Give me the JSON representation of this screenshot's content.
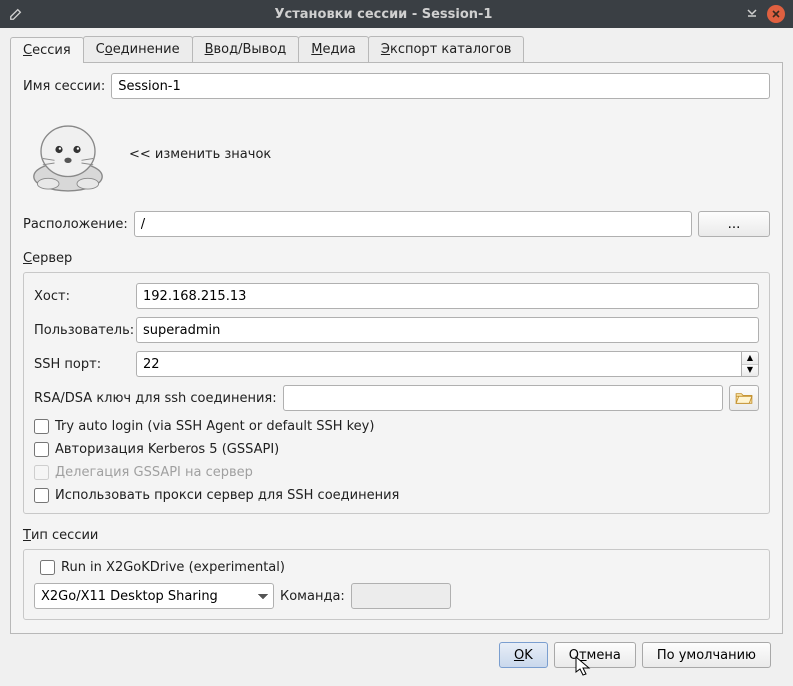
{
  "window": {
    "title": "Установки сессии - Session-1"
  },
  "tabs": {
    "session": "Сессия",
    "connection": "Соединение",
    "io": "Ввод/Вывод",
    "media": "Медиа",
    "export": "Экспорт каталогов"
  },
  "session_name": {
    "label": "Имя сессии:",
    "value": "Session-1"
  },
  "change_icon": "<< изменить значок",
  "location": {
    "label": "Расположение:",
    "value": "/",
    "browse": "..."
  },
  "server": {
    "title": "Сервер",
    "host_label": "Хост:",
    "host_value": "192.168.215.13",
    "user_label": "Пользователь:",
    "user_value": "superadmin",
    "sshport_label": "SSH порт:",
    "sshport_value": "22",
    "rsadsa_label": "RSA/DSA ключ для ssh соединения:",
    "rsadsa_value": "",
    "autologin": "Try auto login (via SSH Agent or default SSH key)",
    "kerberos": "Авторизация Kerberos 5 (GSSAPI)",
    "gssapi_delegate": "Делегация GSSAPI на сервер",
    "proxy": "Использовать прокси сервер для SSH соединения"
  },
  "session_type": {
    "title": "Тип сессии",
    "kdrive": "Run in X2GoKDrive (experimental)",
    "select_value": "X2Go/X11 Desktop Sharing",
    "command_label": "Команда:",
    "command_value": ""
  },
  "buttons": {
    "ok": "OK",
    "cancel": "Отмена",
    "defaults": "По умолчанию"
  }
}
